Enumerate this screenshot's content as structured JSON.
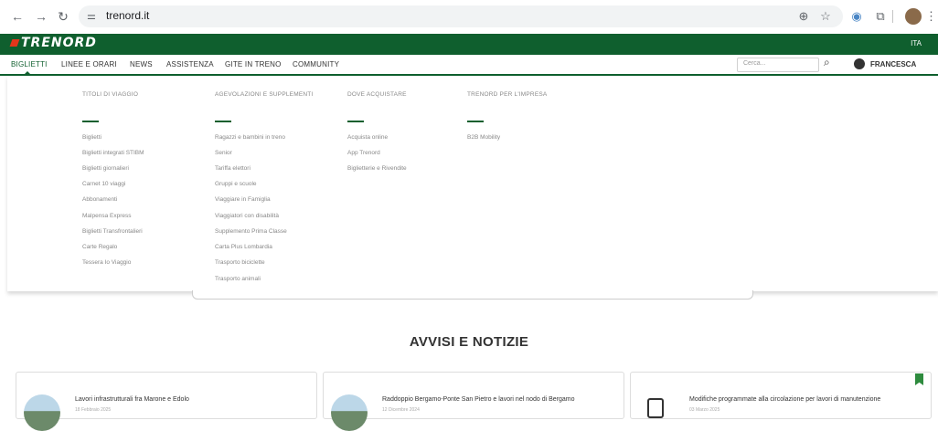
{
  "browser": {
    "url": "trenord.it",
    "icons": [
      "back-icon",
      "forward-icon",
      "reload-icon",
      "tune-icon",
      "zoom-icon",
      "star-icon",
      "extension-icon",
      "puzzle-icon",
      "profile-avatar",
      "more-icon"
    ]
  },
  "site": {
    "logo": "TRENORD",
    "language": "ITA",
    "nav": [
      "BIGLIETTI",
      "LINEE E ORARI",
      "NEWS",
      "ASSISTENZA",
      "GITE IN TRENO",
      "COMMUNITY"
    ],
    "search_placeholder": "Cerca...",
    "user": "FRANCESCA",
    "accent": "#0f5f2e"
  },
  "dropdown": {
    "columns": [
      {
        "title": "TITOLI DI VIAGGIO",
        "links": [
          "Biglietti",
          "Biglietti integrati STIBM",
          "Biglietti giornalieri",
          "Carnet 10 viaggi",
          "Abbonamenti",
          "Malpensa Express",
          "Biglietti Transfrontalieri",
          "Carte Regalo",
          "Tessera Io Viaggio"
        ]
      },
      {
        "title": "AGEVOLAZIONI E SUPPLEMENTI",
        "links": [
          "Ragazzi e bambini in treno",
          "Senior",
          "Tariffa elettori",
          "Gruppi e scuole",
          "Viaggiare in Famiglia",
          "Viaggiatori con disabilità",
          "Supplemento Prima Classe",
          "Carta Plus Lombardia",
          "Trasporto biciclette",
          "Trasporto animali"
        ]
      },
      {
        "title": "DOVE ACQUISTARE",
        "links": [
          "Acquista online",
          "App Trenord",
          "Biglietterie e Rivendite"
        ]
      },
      {
        "title": "TRENORD PER L'IMPRESA",
        "links": [
          "B2B Mobility"
        ]
      }
    ]
  },
  "news": {
    "title": "AVVISI E NOTIZIE",
    "cards": [
      {
        "title": "Lavori infrastrutturali fra Marone e Edolo",
        "date": "18 Febbraio 2025"
      },
      {
        "title": "Raddoppio Bergamo-Ponte San Pietro e lavori nel nodo di Bergamo",
        "date": "12 Dicembre 2024"
      },
      {
        "title": "Modifiche programmate alla circolazione per lavori di manutenzione",
        "date": "03 Marzo 2025"
      }
    ]
  }
}
